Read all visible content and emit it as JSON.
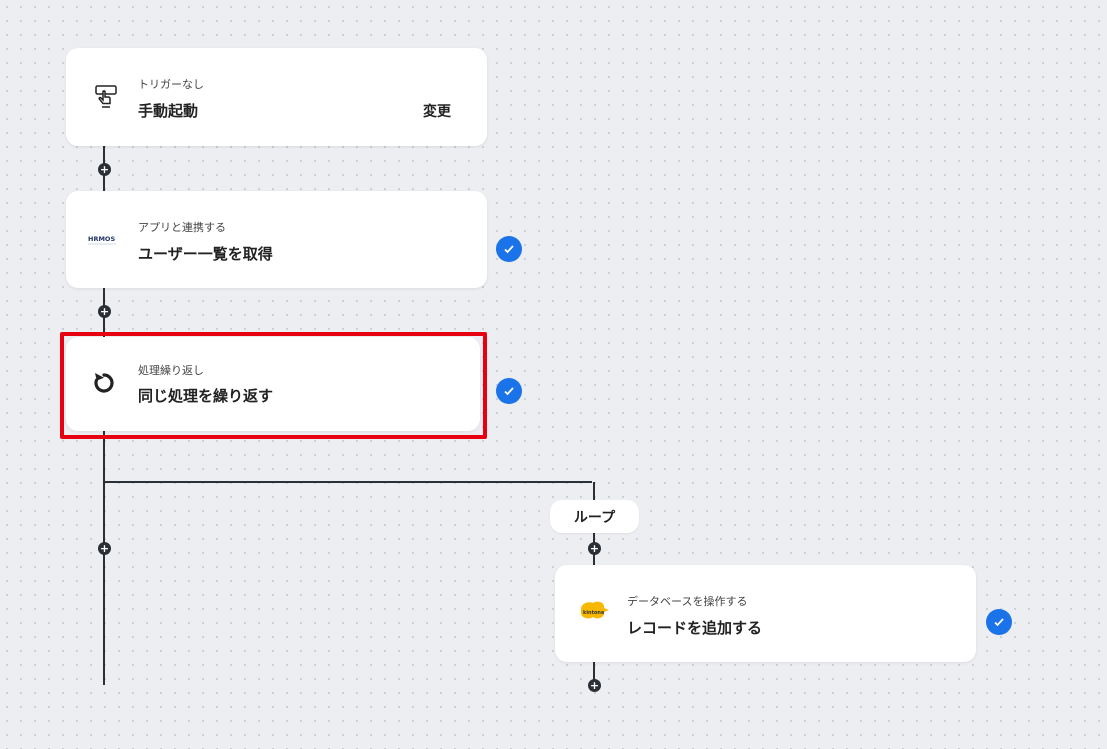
{
  "flow": {
    "trigger": {
      "subtitle": "トリガーなし",
      "title": "手動起動",
      "action_label": "変更",
      "icon": "manual-trigger-icon"
    },
    "step_hrmos": {
      "subtitle": "アプリと連携する",
      "title": "ユーザー一覧を取得",
      "logo_text": "HRMOS",
      "status": "completed"
    },
    "step_loop": {
      "subtitle": "処理繰り返し",
      "title": "同じ処理を繰り返す",
      "icon": "repeat-icon",
      "status": "completed"
    },
    "loop_branch": {
      "label": "ループ"
    },
    "step_kintone": {
      "subtitle": "データベースを操作する",
      "title": "レコードを追加する",
      "logo_text": "kintone",
      "status": "completed"
    }
  },
  "colors": {
    "accent": "#1a73e8",
    "highlight": "#e60012",
    "line": "#2b2f36",
    "kintone": "#f7b900"
  }
}
